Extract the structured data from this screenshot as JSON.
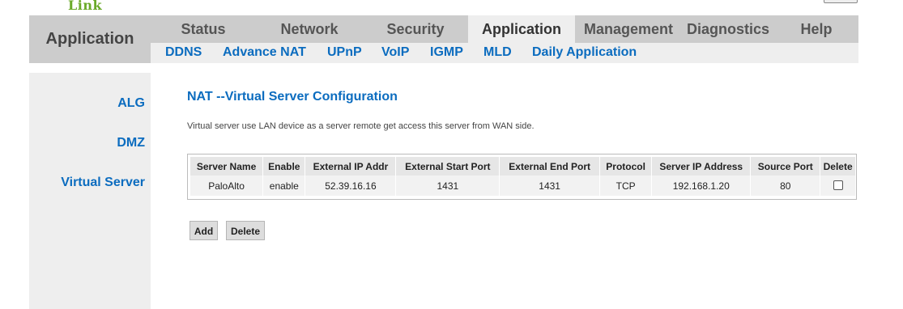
{
  "brand": {
    "logo_text": "Link"
  },
  "header": {
    "section_title": "Application"
  },
  "main_tabs": [
    {
      "label": "Status",
      "active": false
    },
    {
      "label": "Network",
      "active": false
    },
    {
      "label": "Security",
      "active": false
    },
    {
      "label": "Application",
      "active": true
    },
    {
      "label": "Management",
      "active": false
    },
    {
      "label": "Diagnostics",
      "active": false
    },
    {
      "label": "Help",
      "active": false
    }
  ],
  "sub_tabs": [
    {
      "label": "DDNS"
    },
    {
      "label": "Advance NAT"
    },
    {
      "label": "UPnP"
    },
    {
      "label": "VoIP"
    },
    {
      "label": "IGMP"
    },
    {
      "label": "MLD"
    },
    {
      "label": "Daily Application"
    }
  ],
  "sidebar": {
    "items": [
      {
        "label": "ALG"
      },
      {
        "label": "DMZ"
      },
      {
        "label": "Virtual Server"
      }
    ]
  },
  "content": {
    "title": "NAT --Virtual Server Configuration",
    "description": "Virtual server use LAN device as a server remote get access this server from WAN side."
  },
  "table": {
    "headers": [
      "Server Name",
      "Enable",
      "External IP Addr",
      "External Start Port",
      "External End Port",
      "Protocol",
      "Server IP Address",
      "Source Port",
      "Delete"
    ],
    "rows": [
      {
        "server_name": "PaloAlto",
        "enable": "enable",
        "external_ip": "52.39.16.16",
        "external_start_port": "1431",
        "external_end_port": "1431",
        "protocol": "TCP",
        "server_ip": "192.168.1.20",
        "source_port": "80",
        "delete_checked": false
      }
    ]
  },
  "buttons": {
    "add": "Add",
    "delete": "Delete"
  }
}
